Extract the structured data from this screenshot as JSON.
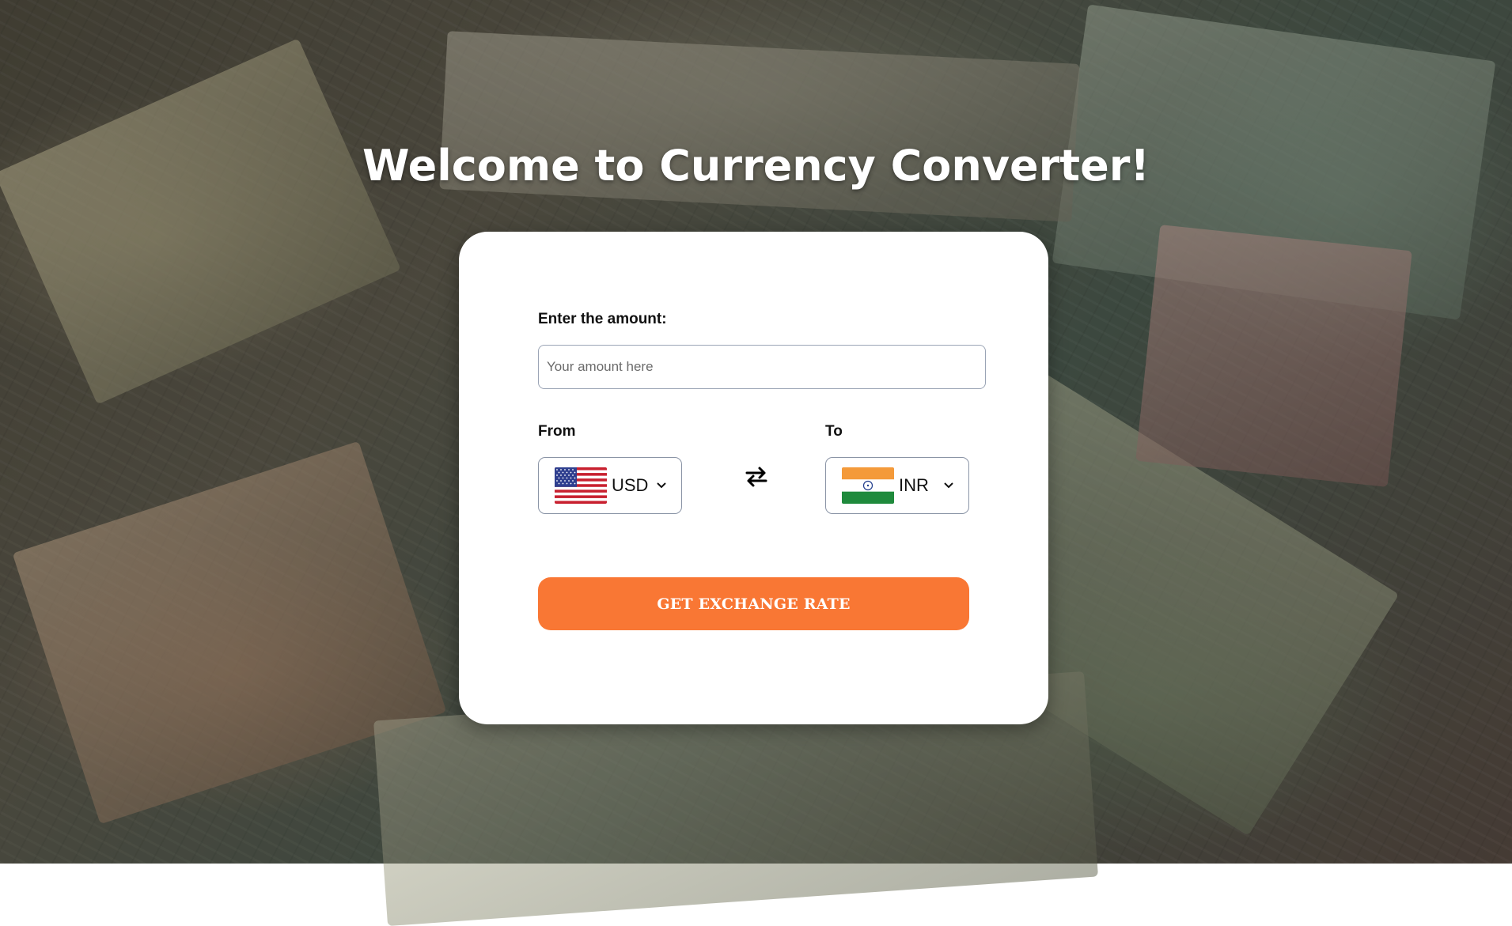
{
  "page": {
    "title": "Welcome to Currency Converter!"
  },
  "form": {
    "amount_label": "Enter the amount:",
    "amount_placeholder": "Your amount here",
    "amount_value": "",
    "from_label": "From",
    "to_label": "To",
    "from_currency": "USD",
    "to_currency": "INR",
    "from_flag": "us-flag-icon",
    "to_flag": "in-flag-icon",
    "swap_icon": "swap-arrows-icon",
    "submit_label": "GET EXCHANGE RATE"
  },
  "colors": {
    "accent": "#f97734",
    "card_bg": "#ffffff",
    "title_text": "#ffffff",
    "input_border": "#9aa4b5"
  }
}
